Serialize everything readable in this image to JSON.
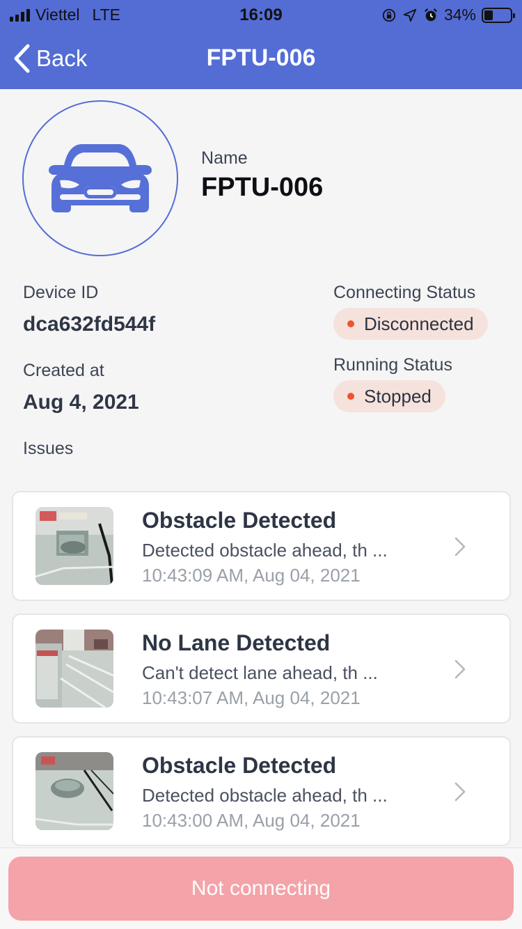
{
  "status_bar": {
    "carrier": "Viettel",
    "network": "LTE",
    "time": "16:09",
    "battery": "34%",
    "battery_level": 0.34,
    "icons": [
      "orientation-lock-icon",
      "location-icon",
      "alarm-icon",
      "battery-icon"
    ]
  },
  "nav": {
    "back_label": "Back",
    "title": "FPTU-006"
  },
  "device": {
    "icon": "car-icon",
    "name_label": "Name",
    "name": "FPTU-006",
    "device_id_label": "Device ID",
    "device_id": "dca632fd544f",
    "created_label": "Created at",
    "created": "Aug 4, 2021",
    "connecting_label": "Connecting Status",
    "connecting_status": "Disconnected",
    "running_label": "Running Status",
    "running_status": "Stopped",
    "status_dot_color": "#f0522d",
    "accent_color": "#536dd5"
  },
  "issues": {
    "label": "Issues",
    "items": [
      {
        "title": "Obstacle Detected",
        "description": "Detected obstacle ahead, th ...",
        "time": "10:43:09 AM, Aug 04, 2021"
      },
      {
        "title": "No Lane Detected",
        "description": "Can't detect lane ahead, th ...",
        "time": "10:43:07 AM, Aug 04, 2021"
      },
      {
        "title": "Obstacle Detected",
        "description": "Detected obstacle ahead, th ...",
        "time": "10:43:00 AM, Aug 04, 2021"
      }
    ]
  },
  "footer": {
    "button_label": "Not connecting",
    "button_color": "#f4a3a9"
  }
}
